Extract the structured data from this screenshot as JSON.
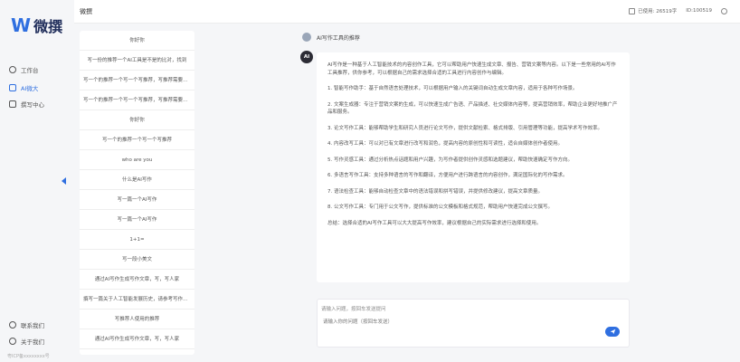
{
  "brand": {
    "mark": "W",
    "name": "微撰"
  },
  "nav": {
    "items": [
      {
        "label": "工作台",
        "icon": "dashboard-icon"
      },
      {
        "label": "AI微大",
        "icon": "calendar-icon"
      },
      {
        "label": "撰写中心",
        "icon": "document-icon"
      }
    ],
    "bottom": [
      {
        "label": "联系我们",
        "icon": "contact-icon"
      },
      {
        "label": "关于我们",
        "icon": "info-icon"
      }
    ],
    "footer_note": "粤ICP备xxxxxxxx号"
  },
  "header": {
    "title": "微撰",
    "usage": "已使用: 26519字",
    "user_id": "ID:100519"
  },
  "history": [
    "你好你",
    "写一份的推荐一个AI工具是不是的比对，找到",
    "写一个的推荐一个写一个写推荐，写推荐需要结合",
    "写一个的推荐一个写一个写推荐，写推荐需要结合",
    "你好你",
    "写一个的推荐一个写一个写推荐",
    "who are you",
    "什么是AI写作",
    "写一篇一个AI写作",
    "写一篇一个AI写作",
    "1+1=",
    "写一段小美文",
    "通过AI写作生成写作文章，写，写人家",
    "撰写一篇关于人工智能发展历史，请参考写作文章，",
    "写推荐人使用的推荐",
    "通过AI写作生成写作文章，写，写人家",
    "写推荐人使用的推荐"
  ],
  "chat": {
    "question": "AI写作工具的推荐",
    "ai_avatar": "AI",
    "answer": [
      "AI写作是一种基于人工智能技术的内容创作工具，它可以帮助用户快速生成文章、报告、营销文案等内容。以下是一些常用的AI写作工具推荐，供你参考，可以根据自己的需求选择合适的工具进行内容创作与编辑。",
      "1. 智能写作助手：基于自然语言处理技术，可以根据用户输入的关键词自动生成文章内容，适用于各种写作场景。",
      "2. 文案生成器：专注于营销文案的生成，可以快速生成广告语、产品描述、社交媒体内容等，提高营销效率，帮助企业更好地推广产品和服务。",
      "3. 论文写作工具：能够帮助学生和研究人员进行论文写作，提供文献检索、格式排版、引用管理等功能，提高学术写作效率。",
      "4. 内容改写工具：可以对已有文章进行改写和润色，提高内容的原创性和可读性，适合自媒体创作者使用。",
      "5. 写作灵感工具：通过分析热点话题和用户兴趣，为写作者提供创作灵感和选题建议，帮助快速确定写作方向。",
      "6. 多语言写作工具：支持多种语言的写作和翻译，方便用户进行跨语言的内容创作，满足国际化的写作需求。",
      "7. 语法检查工具：能够自动检查文章中的语法错误和拼写错误，并提供修改建议，提高文章质量。",
      "8. 公文写作工具：专门用于公文写作，提供标准的公文模板和格式规范，帮助用户快速完成公文撰写。",
      "总结：选择合适的AI写作工具可以大大提高写作效率，建议根据自己的实际需求进行选择和使用。"
    ]
  },
  "input": {
    "label": "请输入问题，按回车发送提问",
    "placeholder": "请输入你的问题（按回车发送）"
  }
}
